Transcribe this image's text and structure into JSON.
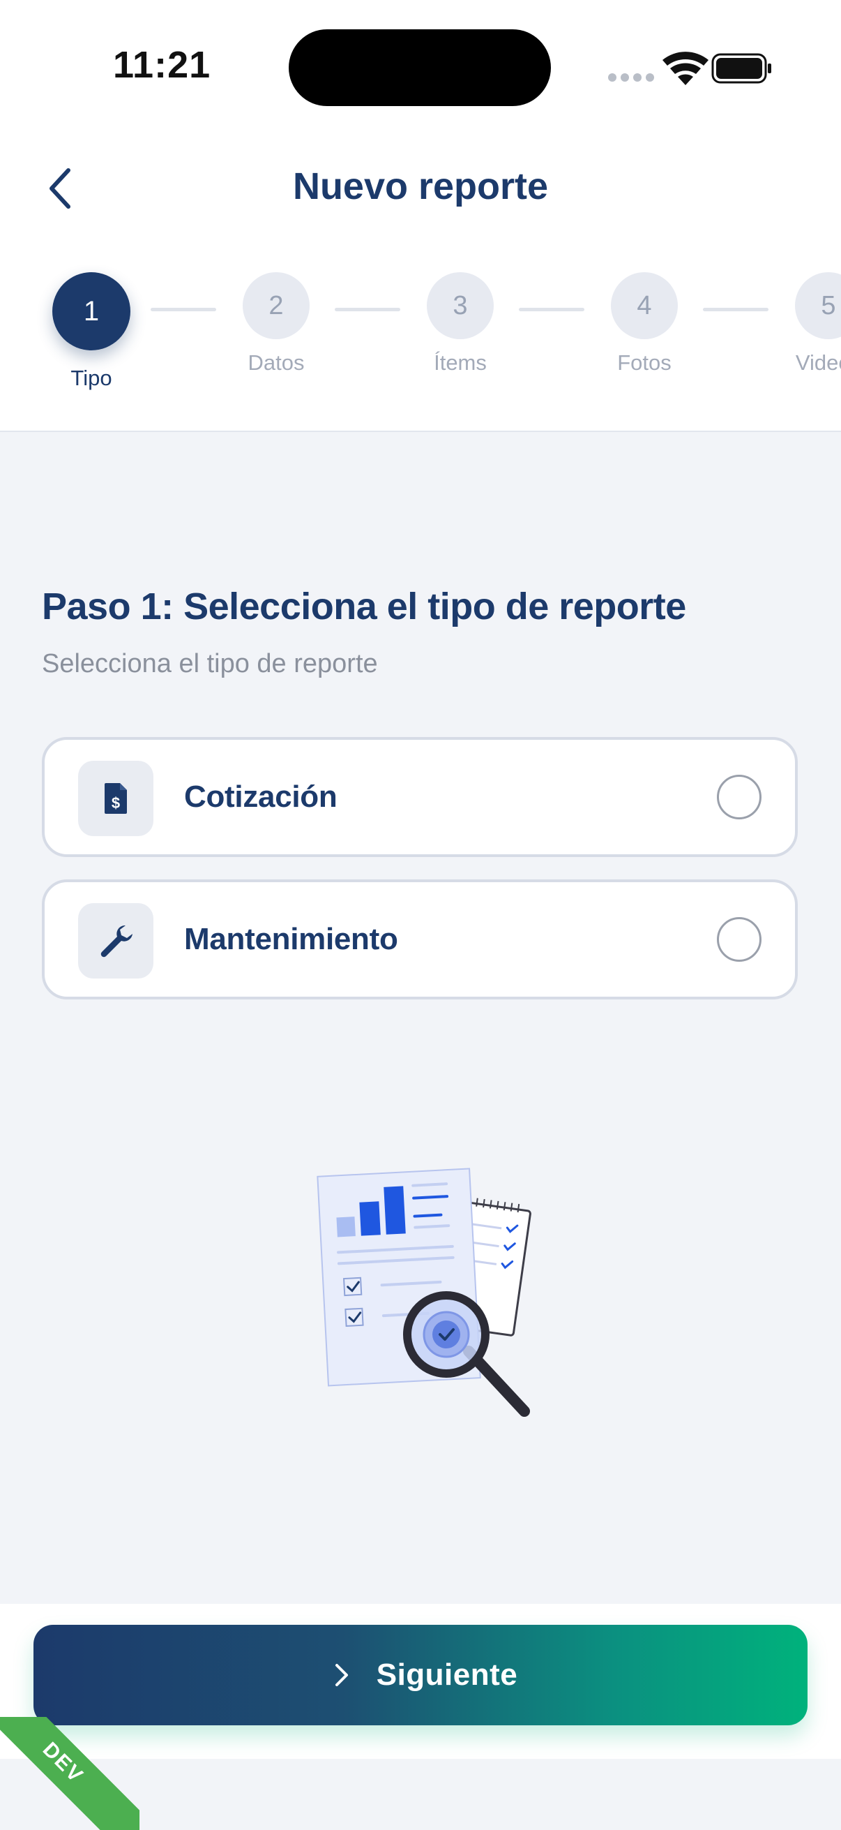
{
  "status_bar": {
    "time": "11:21"
  },
  "header": {
    "title": "Nuevo reporte",
    "back_icon": "chevron-left-icon"
  },
  "stepper": {
    "current_step": 1,
    "steps": [
      {
        "number": "1",
        "label": "Tipo"
      },
      {
        "number": "2",
        "label": "Datos"
      },
      {
        "number": "3",
        "label": "Ítems"
      },
      {
        "number": "4",
        "label": "Fotos"
      },
      {
        "number": "5",
        "label": "Videos"
      }
    ]
  },
  "main": {
    "heading": "Paso 1: Selecciona el tipo de reporte",
    "subheading": "Selecciona el tipo de reporte",
    "options": [
      {
        "label": "Cotización",
        "icon": "invoice-dollar-icon",
        "selected": false
      },
      {
        "label": "Mantenimiento",
        "icon": "wrench-icon",
        "selected": false
      }
    ]
  },
  "footer": {
    "next_label": "Siguiente",
    "next_icon": "chevron-right-icon"
  },
  "badge": {
    "label": "DEV"
  },
  "colors": {
    "primary": "#1c3a6b",
    "accent": "#00b27c",
    "background": "#f2f4f8",
    "ribbon": "#4caf50"
  }
}
